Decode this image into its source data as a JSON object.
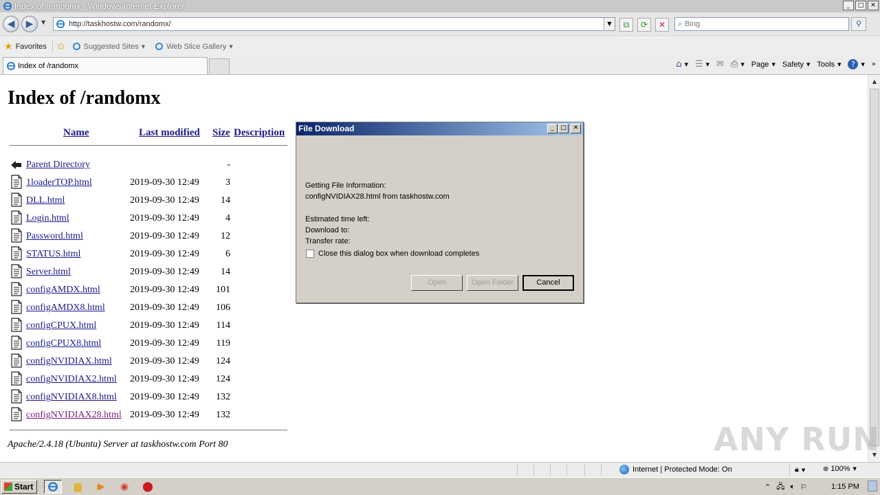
{
  "window": {
    "title": "Index of /randomx - Windows Internet Explorer",
    "controls": [
      "_",
      "□",
      "✕"
    ]
  },
  "toolbar": {
    "address": "http://taskhostw.com/randomx/",
    "search_value": "Bing"
  },
  "favorites_bar": {
    "favorites_label": "Favorites",
    "suggested_sites_label": "Suggested Sites",
    "web_slice_gallery_label": "Web Slice Gallery"
  },
  "tabs": [
    {
      "label": "Index of /randomx",
      "active": true
    }
  ],
  "command_bar": {
    "page_label": "Page",
    "safety_label": "Safety",
    "tools_label": "Tools"
  },
  "page": {
    "heading": "Index of /randomx",
    "columns": {
      "name": "Name",
      "last_modified": "Last modified",
      "size": "Size",
      "description": "Description"
    },
    "parent": {
      "name": "Parent Directory",
      "size": "-"
    },
    "rows": [
      {
        "name": "1loaderTOP.html",
        "modified": "2019-09-30 12:49",
        "size": "3"
      },
      {
        "name": "DLL.html",
        "modified": "2019-09-30 12:49",
        "size": "14"
      },
      {
        "name": "Login.html",
        "modified": "2019-09-30 12:49",
        "size": "4"
      },
      {
        "name": "Password.html",
        "modified": "2019-09-30 12:49",
        "size": "12"
      },
      {
        "name": "STATUS.html",
        "modified": "2019-09-30 12:49",
        "size": "6"
      },
      {
        "name": "Server.html",
        "modified": "2019-09-30 12:49",
        "size": "14"
      },
      {
        "name": "configAMDX.html",
        "modified": "2019-09-30 12:49",
        "size": "101"
      },
      {
        "name": "configAMDX8.html",
        "modified": "2019-09-30 12:49",
        "size": "106"
      },
      {
        "name": "configCPUX.html",
        "modified": "2019-09-30 12:49",
        "size": "114"
      },
      {
        "name": "configCPUX8.html",
        "modified": "2019-09-30 12:49",
        "size": "119"
      },
      {
        "name": "configNVIDIAX.html",
        "modified": "2019-09-30 12:49",
        "size": "124"
      },
      {
        "name": "configNVIDIAX2.html",
        "modified": "2019-09-30 12:49",
        "size": "124"
      },
      {
        "name": "configNVIDIAX8.html",
        "modified": "2019-09-30 12:49",
        "size": "132"
      },
      {
        "name": "configNVIDIAX28.html",
        "modified": "2019-09-30 12:49",
        "size": "132",
        "visited": true
      }
    ],
    "server_signature": "Apache/2.4.18 (Ubuntu) Server at taskhostw.com Port 80"
  },
  "dialog": {
    "title": "File Download",
    "line1": "Getting File Information:",
    "line2": "configNVIDIAX28.html from taskhostw.com",
    "estimated_label": "Estimated time left:",
    "download_to_label": "Download to:",
    "transfer_rate_label": "Transfer rate:",
    "checkbox_label": "Close this dialog box when download completes",
    "checkbox_checked": false,
    "open_label": "Open",
    "open_folder_label": "Open Folder",
    "cancel_label": "Cancel"
  },
  "status_bar": {
    "zone": "Internet | Protected Mode: On",
    "zoom": "100%"
  },
  "taskbar": {
    "start_label": "Start",
    "clock": "1:15 PM"
  },
  "watermark": "ANY RUN",
  "colors": {
    "link": "#1a1a8c",
    "visited_link": "#7a207a",
    "dialog_title_start": "#0a246a",
    "dialog_title_end": "#a6caf0"
  }
}
